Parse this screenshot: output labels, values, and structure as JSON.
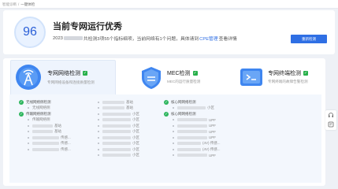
{
  "breadcrumb": {
    "root": "智能诊断",
    "separator": "/",
    "current": "一键体检"
  },
  "summary": {
    "score": "96",
    "title": "当前专网运行优秀",
    "line_prefix": "2023",
    "line_mid": "共检测3项55个指标细项，当前网络有1个问题，具体请到",
    "cpe_link": "CPE管理",
    "line_suffix": "查看详情",
    "rescan_button": "重新检测"
  },
  "tabs": [
    {
      "name": "专网网络检测",
      "desc": "专网网络设备和连接质量检测"
    },
    {
      "name": "MEC检测",
      "desc": "MEC的运行质量检测"
    },
    {
      "name": "专网终端检测",
      "desc": "专网终端的故障告警检测"
    }
  ],
  "col1": {
    "g1": "无线网络侧检测",
    "g1_sub": "无线网络侧",
    "g2": "传输网络侧检测",
    "g2_sub": "传输网络侧",
    "rows": [
      "基站",
      "基站",
      "传感...",
      "传感...",
      "传感..."
    ]
  },
  "col2": {
    "rows": [
      "基站",
      "基站",
      "小区",
      "小区",
      "小区",
      "小区",
      "小区",
      "小区",
      "小区",
      "小区"
    ]
  },
  "col3": {
    "g1": "核心网网络检测",
    "g1_row": "小区",
    "g2": "核心网网络检测",
    "rows": [
      "UPF",
      "UPF",
      "UPF",
      "UPF",
      "(4V) 传感...",
      "(4V) 传感...",
      "UPF"
    ]
  },
  "colors": {
    "accent": "#2f6fe4",
    "ok": "#2db55d",
    "score_text": "#2a5fd7"
  },
  "icons": [
    "network-icon",
    "mec-icon",
    "terminal-icon",
    "check-icon",
    "headset-icon",
    "feedback-icon"
  ]
}
